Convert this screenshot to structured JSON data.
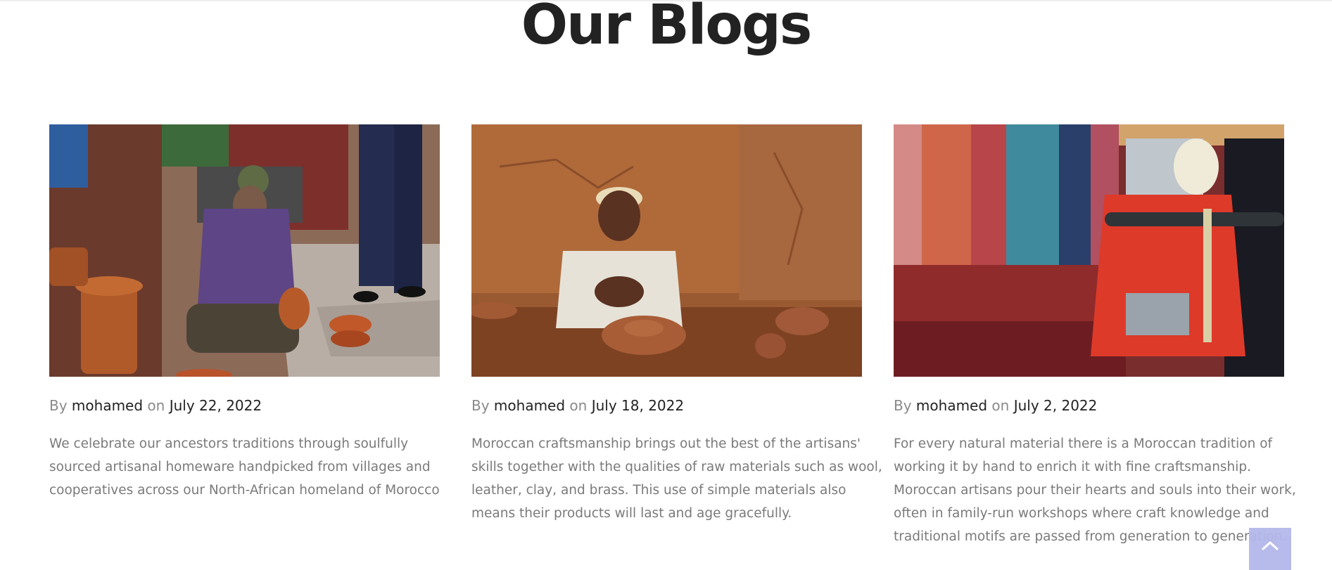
{
  "page": {
    "title": "Our Blogs"
  },
  "posts": [
    {
      "by": "By",
      "author": "mohamed",
      "on": "on",
      "date": "July 22, 2022",
      "image": "copper-artisan-photo",
      "excerpt": [
        "We celebrate our ancestors traditions through soulfully",
        "sourced artisanal homeware handpicked from villages and",
        "cooperatives across our North-African homeland of Morocco"
      ]
    },
    {
      "by": "By",
      "author": "mohamed",
      "on": "on",
      "date": "July 18, 2022",
      "image": "potter-artisan-photo",
      "excerpt": [
        "Moroccan craftsmanship brings out the best of the artisans'",
        "skills together with the qualities of raw materials such as wool,",
        "leather, clay, and brass. This use of simple materials also",
        "means their products will last and age gracefully."
      ]
    },
    {
      "by": "By",
      "author": "mohamed",
      "on": "on",
      "date": "July 2, 2022",
      "image": "weaver-artisan-photo",
      "excerpt": [
        "For every natural material there is a Moroccan tradition of",
        "working it by hand to enrich it with fine craftsmanship.",
        "Moroccan artisans pour their hearts and souls into their work,",
        "often in family-run workshops where craft knowledge and",
        "traditional motifs are passed from generation to generation."
      ]
    }
  ],
  "scroll_top": {
    "icon": "chevron-up-icon",
    "color": "#b4b8ea"
  }
}
